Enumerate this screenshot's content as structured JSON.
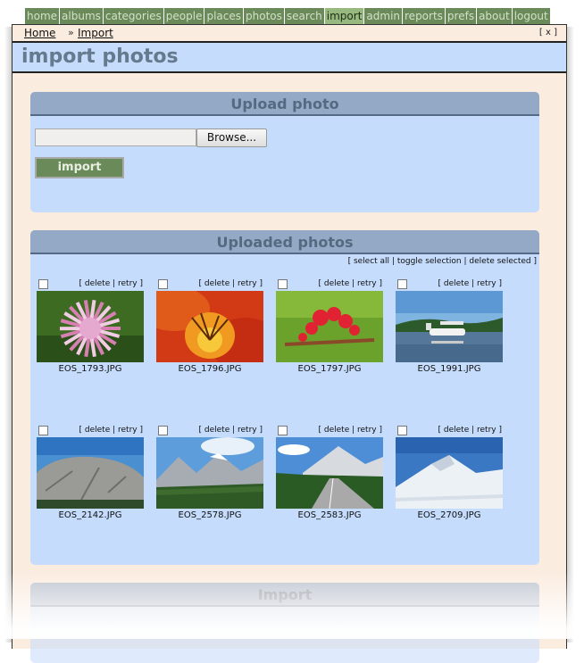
{
  "menu": {
    "items": [
      "home",
      "albums",
      "categories",
      "people",
      "places",
      "photos",
      "search",
      "import",
      "admin",
      "reports",
      "prefs",
      "about",
      "logout"
    ],
    "active": "import"
  },
  "breadcrumb": {
    "home": "Home",
    "sep": "»",
    "current": "Import"
  },
  "close_label": "[ x ]",
  "page_title": "import photos",
  "upload_panel": {
    "title": "Upload photo",
    "browse_label": "Browse...",
    "import_label": "import"
  },
  "uploaded_panel": {
    "title": "Uploaded photos",
    "select_all": "select all",
    "toggle_selection": "toggle selection",
    "delete_selected": "delete selected",
    "delete_label": "delete",
    "retry_label": "retry",
    "photos": [
      {
        "filename": "EOS_1793.JPG",
        "subject": "pink-spiky-flower"
      },
      {
        "filename": "EOS_1796.JPG",
        "subject": "orange-lily"
      },
      {
        "filename": "EOS_1797.JPG",
        "subject": "red-flower-stems"
      },
      {
        "filename": "EOS_1991.JPG",
        "subject": "floatplane-on-lake"
      },
      {
        "filename": "EOS_2142.JPG",
        "subject": "granite-dome"
      },
      {
        "filename": "EOS_2578.JPG",
        "subject": "mountain-valley"
      },
      {
        "filename": "EOS_2583.JPG",
        "subject": "mountain-road"
      },
      {
        "filename": "EOS_2709.JPG",
        "subject": "snowy-peak"
      }
    ]
  },
  "import_panel": {
    "title": "Import"
  },
  "colors": {
    "menu_bg": "#6b8a5a",
    "menu_active_bg": "#97b97f",
    "panel_bg": "#c5dcfc",
    "panel_header": "#93a9c5",
    "window_bg": "#fbece0"
  }
}
